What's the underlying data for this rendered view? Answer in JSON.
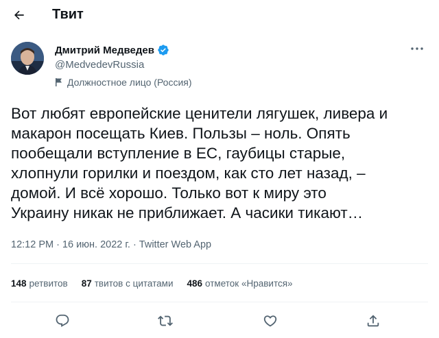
{
  "header": {
    "back_icon": "arrow-left-icon",
    "title": "Твит"
  },
  "tweet": {
    "author": {
      "name": "Дмитрий Медведев",
      "handle": "@MedvedevRussia",
      "verified": true,
      "verified_color": "#1d9bf0",
      "label_icon": "flag-icon",
      "label": "Должностное лицо (Россия)"
    },
    "more_icon": "more-icon",
    "text": "Вот любят европейские ценители лягушек, ливера и\nмакарон посещать Киев. Пользы – ноль. Опять\nпообещали вступление в ЕС, гаубицы старые,\nхлопнули горилки и поездом, как сто лет назад, –\nдомой. И всё хорошо. Только вот к миру это\nУкраину никак не приближает. А часики тикают…",
    "time": "12:12 PM",
    "sep1": "·",
    "date": "16 июн. 2022 г.",
    "sep2": "·",
    "source": "Twitter Web App",
    "stats": {
      "retweets_count": "148",
      "retweets_label": "ретвитов",
      "quotes_count": "87",
      "quotes_label": "твитов с цитатами",
      "likes_count": "486",
      "likes_label": "отметок «Нравится»"
    },
    "actions": [
      "reply-icon",
      "retweet-icon",
      "like-icon",
      "share-icon"
    ]
  },
  "colors": {
    "text": "#0f1419",
    "secondary": "#536471",
    "divider": "#eff3f4",
    "accent": "#1d9bf0"
  }
}
